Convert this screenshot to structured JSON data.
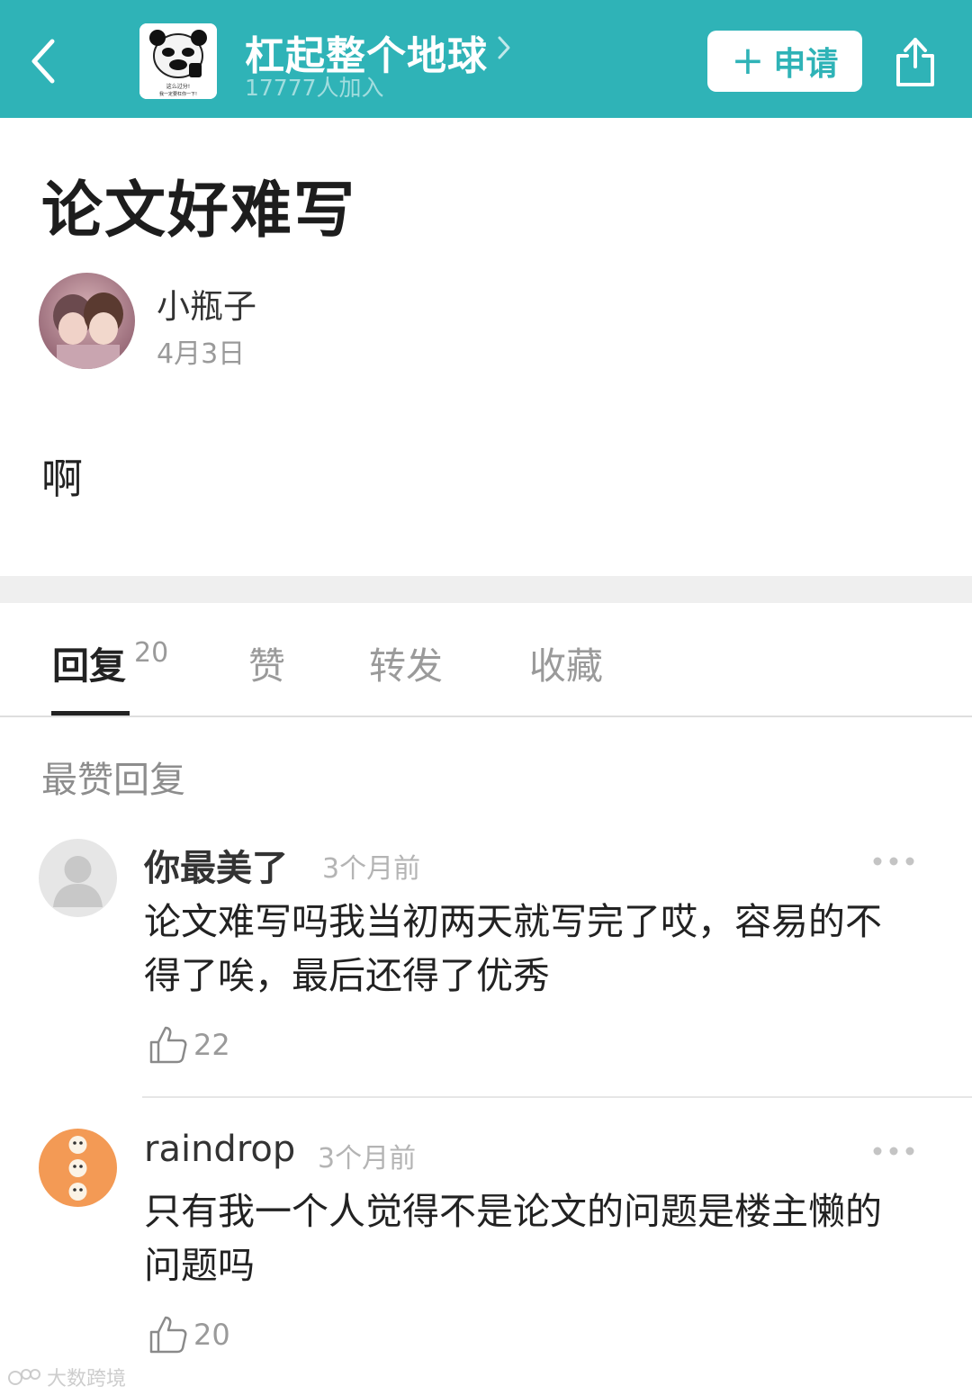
{
  "header": {
    "group_name": "杠起整个地球",
    "member_count": "17777人加入",
    "apply_label": "申请",
    "apply_plus": "+",
    "avatar_caption_1": "这么过分!",
    "avatar_caption_2": "我一定要杠你一下!"
  },
  "post": {
    "title": "论文好难写",
    "author": "小瓶子",
    "date": "4月3日",
    "body": "啊"
  },
  "tabs": {
    "items": [
      {
        "label": "回复"
      },
      {
        "label": "赞"
      },
      {
        "label": "转发"
      },
      {
        "label": "收藏"
      }
    ],
    "reply_count": "20"
  },
  "section": {
    "label": "最赞回复"
  },
  "comments": [
    {
      "user": "你最美了",
      "time": "3个月前",
      "text": "论文难写吗我当初两天就写完了哎，容易的不得了唉，最后还得了优秀",
      "likes": "22"
    },
    {
      "user": "raindrop",
      "time": "3个月前",
      "text": "只有我一个人觉得不是论文的问题是楼主懒的问题吗",
      "likes": "20"
    }
  ],
  "watermark": "大数跨境",
  "colors": {
    "brand": "#2fb3b7",
    "section_gap": "#efefef"
  },
  "icons": {
    "back": "chevron-left-icon",
    "share": "share-icon",
    "more": "more-dots-icon",
    "like": "thumbs-up-icon"
  }
}
